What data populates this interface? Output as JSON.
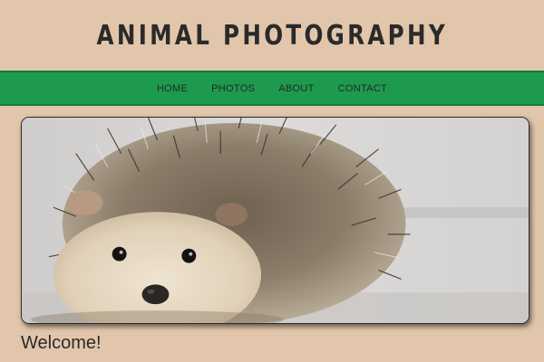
{
  "header": {
    "title": "ANIMAL PHOTOGRAPHY"
  },
  "nav": {
    "items": [
      {
        "label": "HOME"
      },
      {
        "label": "PHOTOS"
      },
      {
        "label": "ABOUT"
      },
      {
        "label": "CONTACT"
      }
    ]
  },
  "hero": {
    "subject": "hedgehog"
  },
  "main": {
    "heading": "Welcome!",
    "intro": ""
  },
  "colors": {
    "page_background": "#e2c6ab",
    "nav_background": "#1e9a4f",
    "text": "#2a2a2a"
  }
}
